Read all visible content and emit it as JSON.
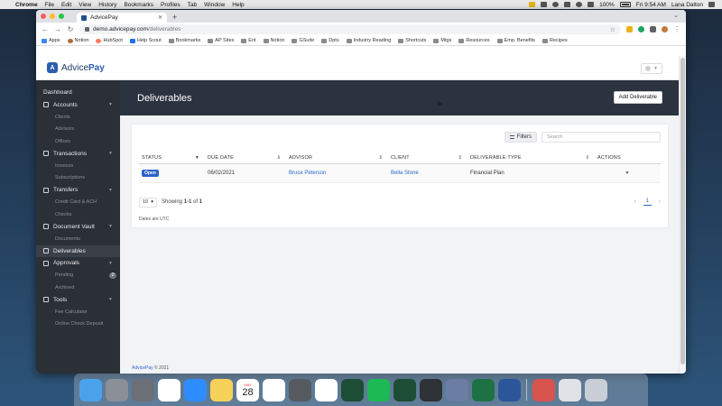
{
  "menubar": {
    "app_name": "Chrome",
    "menus": [
      "File",
      "Edit",
      "View",
      "History",
      "Bookmarks",
      "Profiles",
      "Tab",
      "Window",
      "Help"
    ],
    "battery": "100%",
    "datetime": "Fri 9:54 AM",
    "user": "Lana Dalton"
  },
  "browser": {
    "tab_title": "AdvicePay",
    "url_host": "demo.advicepay.com",
    "url_path": "/deliverables",
    "bookmarks": [
      {
        "label": "Apps",
        "icon": "apps-grid-icon"
      },
      {
        "label": "Notion",
        "icon": "person-icon"
      },
      {
        "label": "HubSpot",
        "icon": "hubspot-icon"
      },
      {
        "label": "Help Scout",
        "icon": "helpscout-icon"
      },
      {
        "label": "Bookmarks",
        "icon": "folder-icon"
      },
      {
        "label": "AP Sites",
        "icon": "folder-icon"
      },
      {
        "label": "Ent",
        "icon": "folder-icon"
      },
      {
        "label": "Notion",
        "icon": "folder-icon"
      },
      {
        "label": "GSuite",
        "icon": "folder-icon"
      },
      {
        "label": "Dpts",
        "icon": "folder-icon"
      },
      {
        "label": "Industry Reading",
        "icon": "folder-icon"
      },
      {
        "label": "Shortcuts",
        "icon": "folder-icon"
      },
      {
        "label": "Mtgs",
        "icon": "folder-icon"
      },
      {
        "label": "Resources",
        "icon": "folder-icon"
      },
      {
        "label": "Emp. Benefits",
        "icon": "folder-icon"
      },
      {
        "label": "Recipes",
        "icon": "folder-icon"
      }
    ]
  },
  "app": {
    "logo_text_a": "Advice",
    "logo_text_b": "Pay"
  },
  "sidebar": {
    "items": [
      {
        "label": "Dashboard",
        "type": "item"
      },
      {
        "label": "Accounts",
        "type": "item",
        "expandable": true
      },
      {
        "label": "Clients",
        "type": "sub"
      },
      {
        "label": "Advisors",
        "type": "sub"
      },
      {
        "label": "Offices",
        "type": "sub"
      },
      {
        "label": "Transactions",
        "type": "item",
        "expandable": true
      },
      {
        "label": "Invoices",
        "type": "sub"
      },
      {
        "label": "Subscriptions",
        "type": "sub"
      },
      {
        "label": "Transfers",
        "type": "item",
        "expandable": true
      },
      {
        "label": "Credit Card & ACH",
        "type": "sub"
      },
      {
        "label": "Checks",
        "type": "sub"
      },
      {
        "label": "Document Vault",
        "type": "item",
        "expandable": true
      },
      {
        "label": "Documents",
        "type": "sub"
      },
      {
        "label": "Deliverables",
        "type": "item",
        "active": true
      },
      {
        "label": "Approvals",
        "type": "item",
        "expandable": true
      },
      {
        "label": "Pending",
        "type": "sub",
        "badge": "0"
      },
      {
        "label": "Archived",
        "type": "sub"
      },
      {
        "label": "Tools",
        "type": "item",
        "expandable": true
      },
      {
        "label": "Fee Calculator",
        "type": "sub"
      },
      {
        "label": "Online Check Deposit",
        "type": "sub"
      }
    ]
  },
  "page": {
    "title": "Deliverables",
    "add_button": "Add Deliverable",
    "filters_button": "Filters",
    "search_placeholder": "Search"
  },
  "table": {
    "headers": [
      "STATUS",
      "DUE DATE",
      "ADVISOR",
      "CLIENT",
      "DELIVERABLE TYPE",
      "ACTIONS"
    ],
    "rows": [
      {
        "status": "Open",
        "due_date": "06/02/2021",
        "advisor": "Bruce Peterson",
        "client": "Bella Stone",
        "type": "Financial Plan"
      }
    ]
  },
  "pagination": {
    "page_size": "10",
    "showing_prefix": "Showing ",
    "showing_range": "1-1",
    "showing_of": " of ",
    "showing_total": "1",
    "current_page": "1",
    "prev": "‹",
    "next": "›"
  },
  "notes": {
    "dates_utc": "Dates are UTC"
  },
  "footer": {
    "brand": "AdvicePay",
    "year": " © 2021"
  },
  "dock": {
    "apps": [
      {
        "name": "finder",
        "color": "#4aa3ea"
      },
      {
        "name": "launchpad",
        "color": "#8a8f98"
      },
      {
        "name": "system-preferences",
        "color": "#6b6f76"
      },
      {
        "name": "slack",
        "color": "#ffffff"
      },
      {
        "name": "zoom",
        "color": "#2d8cff"
      },
      {
        "name": "notes",
        "color": "#f7d25a"
      },
      {
        "name": "calendar",
        "color": "#ffffff"
      },
      {
        "name": "chrome",
        "color": "#ffffff"
      },
      {
        "name": "numbers",
        "color": "#555a60"
      },
      {
        "name": "notion",
        "color": "#ffffff"
      },
      {
        "name": "app-green-1",
        "color": "#1d4d34"
      },
      {
        "name": "spotify",
        "color": "#1db954"
      },
      {
        "name": "app-green-2",
        "color": "#1d4d34"
      },
      {
        "name": "cloud-app",
        "color": "#2e3136"
      },
      {
        "name": "preview",
        "color": "#6b7da3"
      },
      {
        "name": "excel",
        "color": "#1e7145"
      },
      {
        "name": "word",
        "color": "#2b579a"
      },
      {
        "name": "app-red",
        "color": "#d9534f"
      },
      {
        "name": "mail-window",
        "color": "#dfe3e8"
      },
      {
        "name": "trash",
        "color": "#c9ced6"
      }
    ],
    "calendar_month": "MAY",
    "calendar_day": "28"
  },
  "colors": {
    "accent": "#2a66c8",
    "sidebar_bg": "#2b2f36",
    "hero_bg": "#2b3340",
    "status_open": "#2c62c8",
    "fab": "#1f6bd6"
  }
}
